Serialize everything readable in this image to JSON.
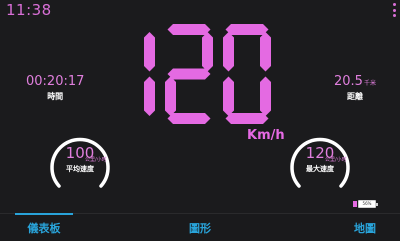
{
  "status_bar": {
    "time": "11:38"
  },
  "speedometer": {
    "speed": "120",
    "unit": "Km/h"
  },
  "trip": {
    "duration": {
      "value": "00:20:17",
      "label": "時間"
    },
    "distance": {
      "value": "20.5",
      "unit": "千米",
      "label": "距離"
    }
  },
  "gauges": {
    "average": {
      "value": "100",
      "unit": "公里/小时",
      "label": "平均速度"
    },
    "max": {
      "value": "120",
      "unit": "公里/小时",
      "label": "最大速度"
    }
  },
  "battery": {
    "percent_label": "56%",
    "level": 0.56
  },
  "tabs": [
    {
      "label": "儀表板",
      "active": true
    },
    {
      "label": "圖形",
      "active": false
    },
    {
      "label": "地圖",
      "active": false
    }
  ],
  "colors": {
    "accent": "#e46ae2",
    "tab": "#29a3d9",
    "background": "#1b1b1d"
  }
}
